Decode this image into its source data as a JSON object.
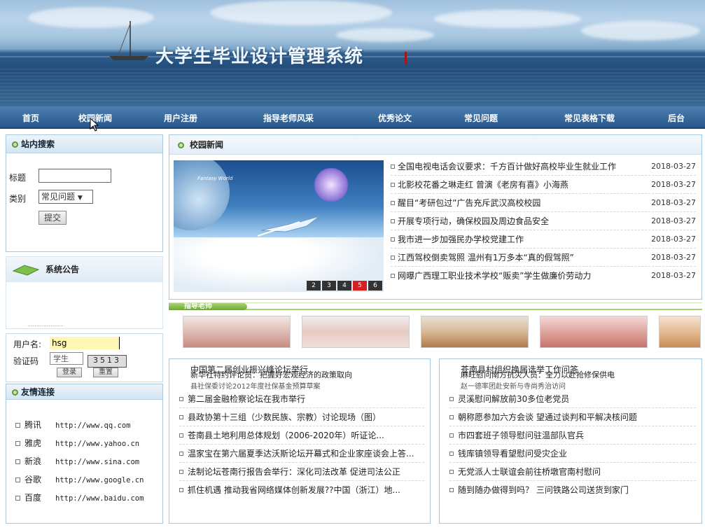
{
  "site_title": "大学生毕业设计管理系统",
  "nav": [
    "首页",
    "校园新闻",
    "用户注册",
    "指导老师风采",
    "优秀论文",
    "常见问题",
    "常见表格下载",
    "后台"
  ],
  "search": {
    "heading": "站内搜索",
    "title_label": "标题",
    "title_value": "",
    "category_label": "类别",
    "category_value": "常见问题",
    "submit": "提交"
  },
  "notice": {
    "heading": "系统公告",
    "scroll_text": "...................."
  },
  "login": {
    "username_label": "用户名:",
    "username_value": "hsg",
    "role_label": "学生",
    "code_label": "验证码",
    "code_overlap": "3513",
    "btn_login": "登录",
    "btn_reset": "重置"
  },
  "links": {
    "heading": "友情连接",
    "items": [
      {
        "name": "腾讯",
        "url": "http://www.qq.com"
      },
      {
        "name": "雅虎",
        "url": "http://www.yahoo.cn"
      },
      {
        "name": "新浪",
        "url": "http://www.sina.com"
      },
      {
        "name": "谷歌",
        "url": "http://www.google.cn"
      },
      {
        "name": "百度",
        "url": "http://www.baidu.com"
      }
    ]
  },
  "news": {
    "heading": "校园新闻",
    "slider_pages": [
      "2",
      "3",
      "4",
      "5",
      "6"
    ],
    "slider_active": "5",
    "image_caption": "Fantasy World",
    "items": [
      {
        "title": "全国电视电话会议要求：千方百计做好高校毕业生就业工作",
        "date": "2018-03-27"
      },
      {
        "title": "北影校花番之琳走红 曾演《老房有喜》小海燕",
        "date": "2018-03-27"
      },
      {
        "title": "醒目“考研包过”广告充斥武汉高校校园",
        "date": "2018-03-27"
      },
      {
        "title": "开展专项行动，确保校园及周边食品安全",
        "date": "2018-03-27"
      },
      {
        "title": "我市进一步加强民办学校党建工作",
        "date": "2018-03-27"
      },
      {
        "title": "江西驾校倒卖驾照 温州有1万多本“真的假驾照”",
        "date": "2018-03-27"
      },
      {
        "title": "网曝广西理工职业技术学校“贩卖”学生做廉价劳动力",
        "date": "2018-03-27"
      }
    ]
  },
  "teacher": {
    "heading": "指导老师"
  },
  "left_list": {
    "overlap_a": "中国第二届创业振兴峰论坛举行",
    "overlap_b": "新华社特约评论员：把握好宏观经济的政策取向",
    "overlap_c": "县社保委讨论2012年度社保基金预算草案",
    "items": [
      "第二届金融检察论坛在我市举行",
      "县政协第十三组（少数民族、宗教）讨论现场（图）",
      "苍南县土地利用总体规划（2006-2020年）听证论...",
      "温家宝在第六届夏季达沃斯论坛开幕式和企业家座谈会上答...",
      "法制论坛苍南行报告会举行：深化司法改革 促进司法公正",
      "抓住机遇 推动我省网络媒体创新发展??中国（浙江）地..."
    ]
  },
  "right_list": {
    "overlap_a": "苍南县村组织换届选举工作问答",
    "overlap_b": "麻旺慰问南方抗灾人员：全力以赴抢修保供电",
    "overlap_c": "赵一德率团赴安新与寺尚秀治访问",
    "items": [
      "灵溪慰问解放前30多位老党员",
      "朝称愿参加六方会谈 望通过谈判和平解决核问题",
      "市四套班子领导慰问驻温部队官兵",
      "钱库镇领导看望慰问受灾企业",
      "无党派人士联谊会前往桥墩官南村慰问",
      "随到随办做得到吗？ 三问铁路公司送货到家门"
    ]
  },
  "colors": {
    "nav_bg": "#2f6297",
    "border": "#a9c6df",
    "active_page": "#d42020",
    "accent_green": "#6ea63a"
  }
}
